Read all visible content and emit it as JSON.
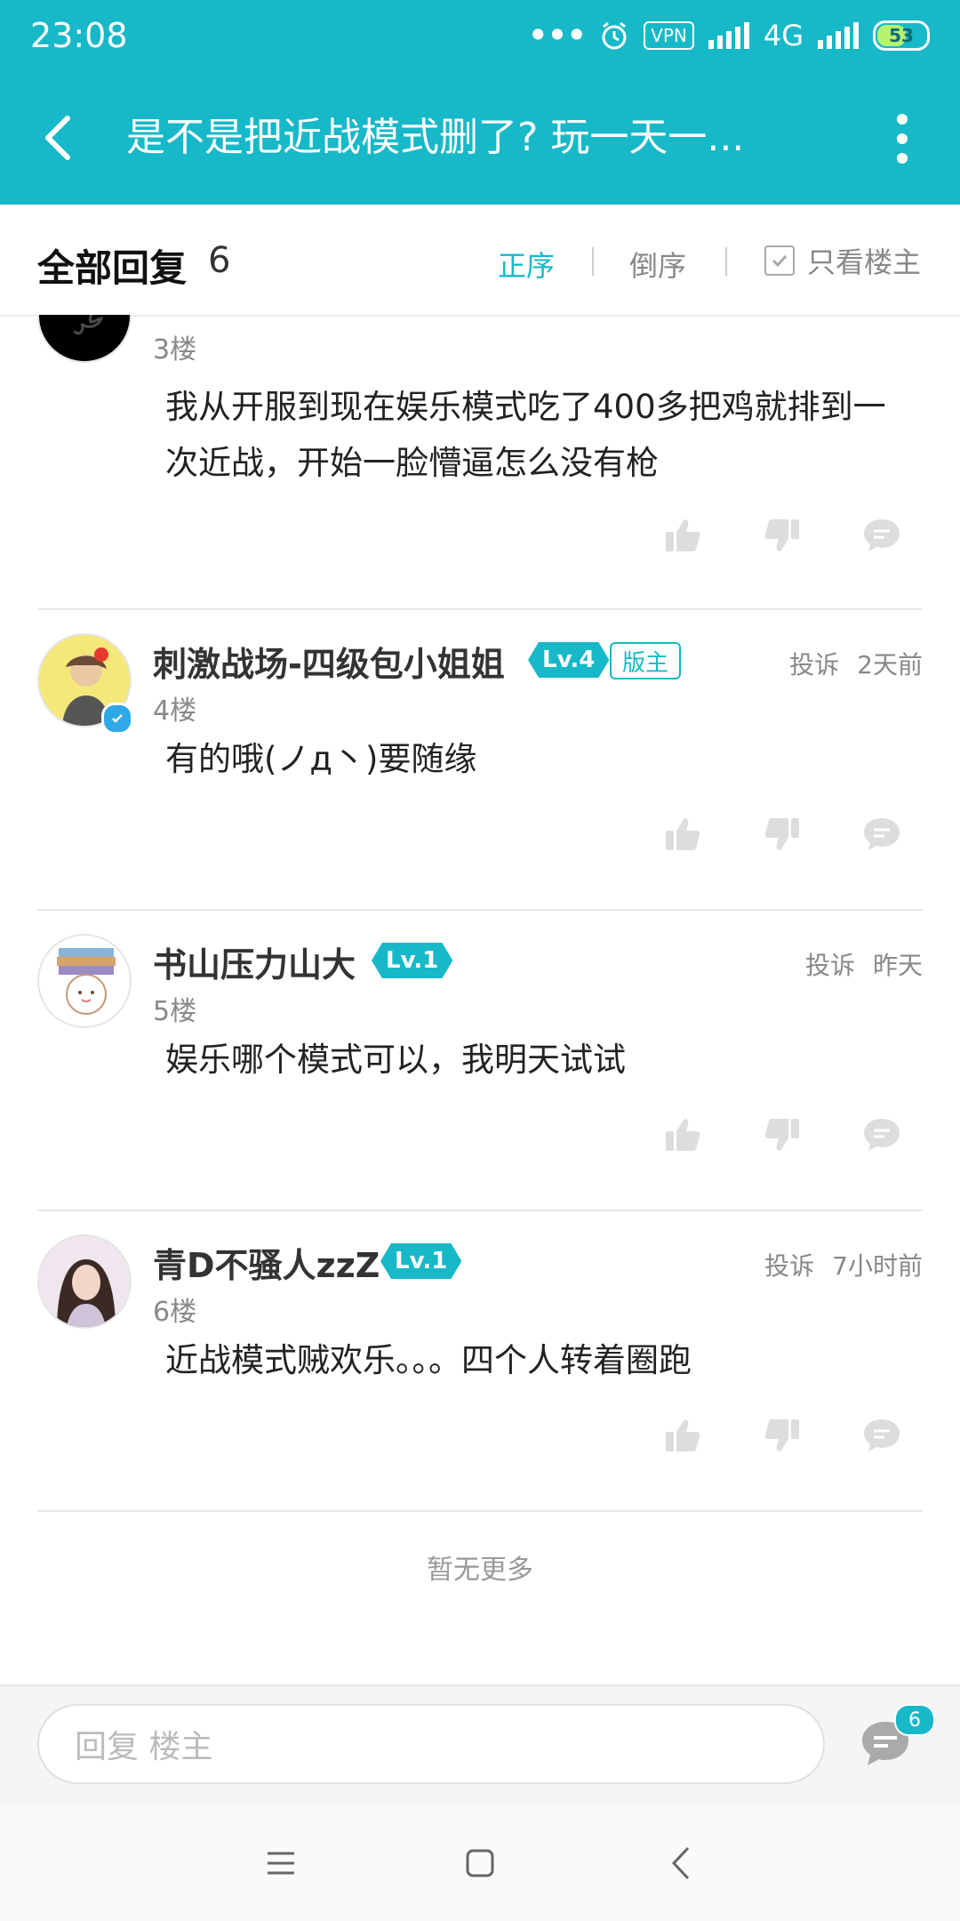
{
  "status_bar": {
    "time": "23:08",
    "network": "4G",
    "vpn": "VPN",
    "battery": "53"
  },
  "header": {
    "title": "是不是把近战模式删了? 玩一天一..."
  },
  "reply_header": {
    "title": "全部回复",
    "count": "6",
    "sort_asc": "正序",
    "sort_desc": "倒序",
    "only_owner": "只看楼主"
  },
  "replies": [
    {
      "floor": "3楼",
      "content": "我从开服到现在娱乐模式吃了400多把鸡就排到一次近战，开始一脸懵逼怎么没有枪"
    },
    {
      "name": "刺激战场-四级包小姐姐",
      "level": "Lv.4",
      "badge": "版主",
      "report": "投诉",
      "time": "2天前",
      "floor": "4楼",
      "content": "有的哦(ノд丶)要随缘"
    },
    {
      "name": "书山压力山大",
      "level": "Lv.1",
      "report": "投诉",
      "time": "昨天",
      "floor": "5楼",
      "content": "娱乐哪个模式可以，我明天试试"
    },
    {
      "name": "青D不骚人zzZ",
      "level": "Lv.1",
      "report": "投诉",
      "time": "7小时前",
      "floor": "6楼",
      "content": "近战模式贼欢乐。。。四个人转着圈跑"
    }
  ],
  "no_more": "暂无更多",
  "input": {
    "placeholder": "回复  楼主",
    "badge_count": "6"
  },
  "icons": [
    "back-icon",
    "more-icon",
    "checkbox-icon",
    "thumbs-up-icon",
    "thumbs-down-icon",
    "comment-icon",
    "chat-icon",
    "menu-icon",
    "home-icon",
    "back-nav-icon"
  ],
  "colors": {
    "accent": "#17b8c8",
    "text": "#222222",
    "muted": "#888888"
  }
}
